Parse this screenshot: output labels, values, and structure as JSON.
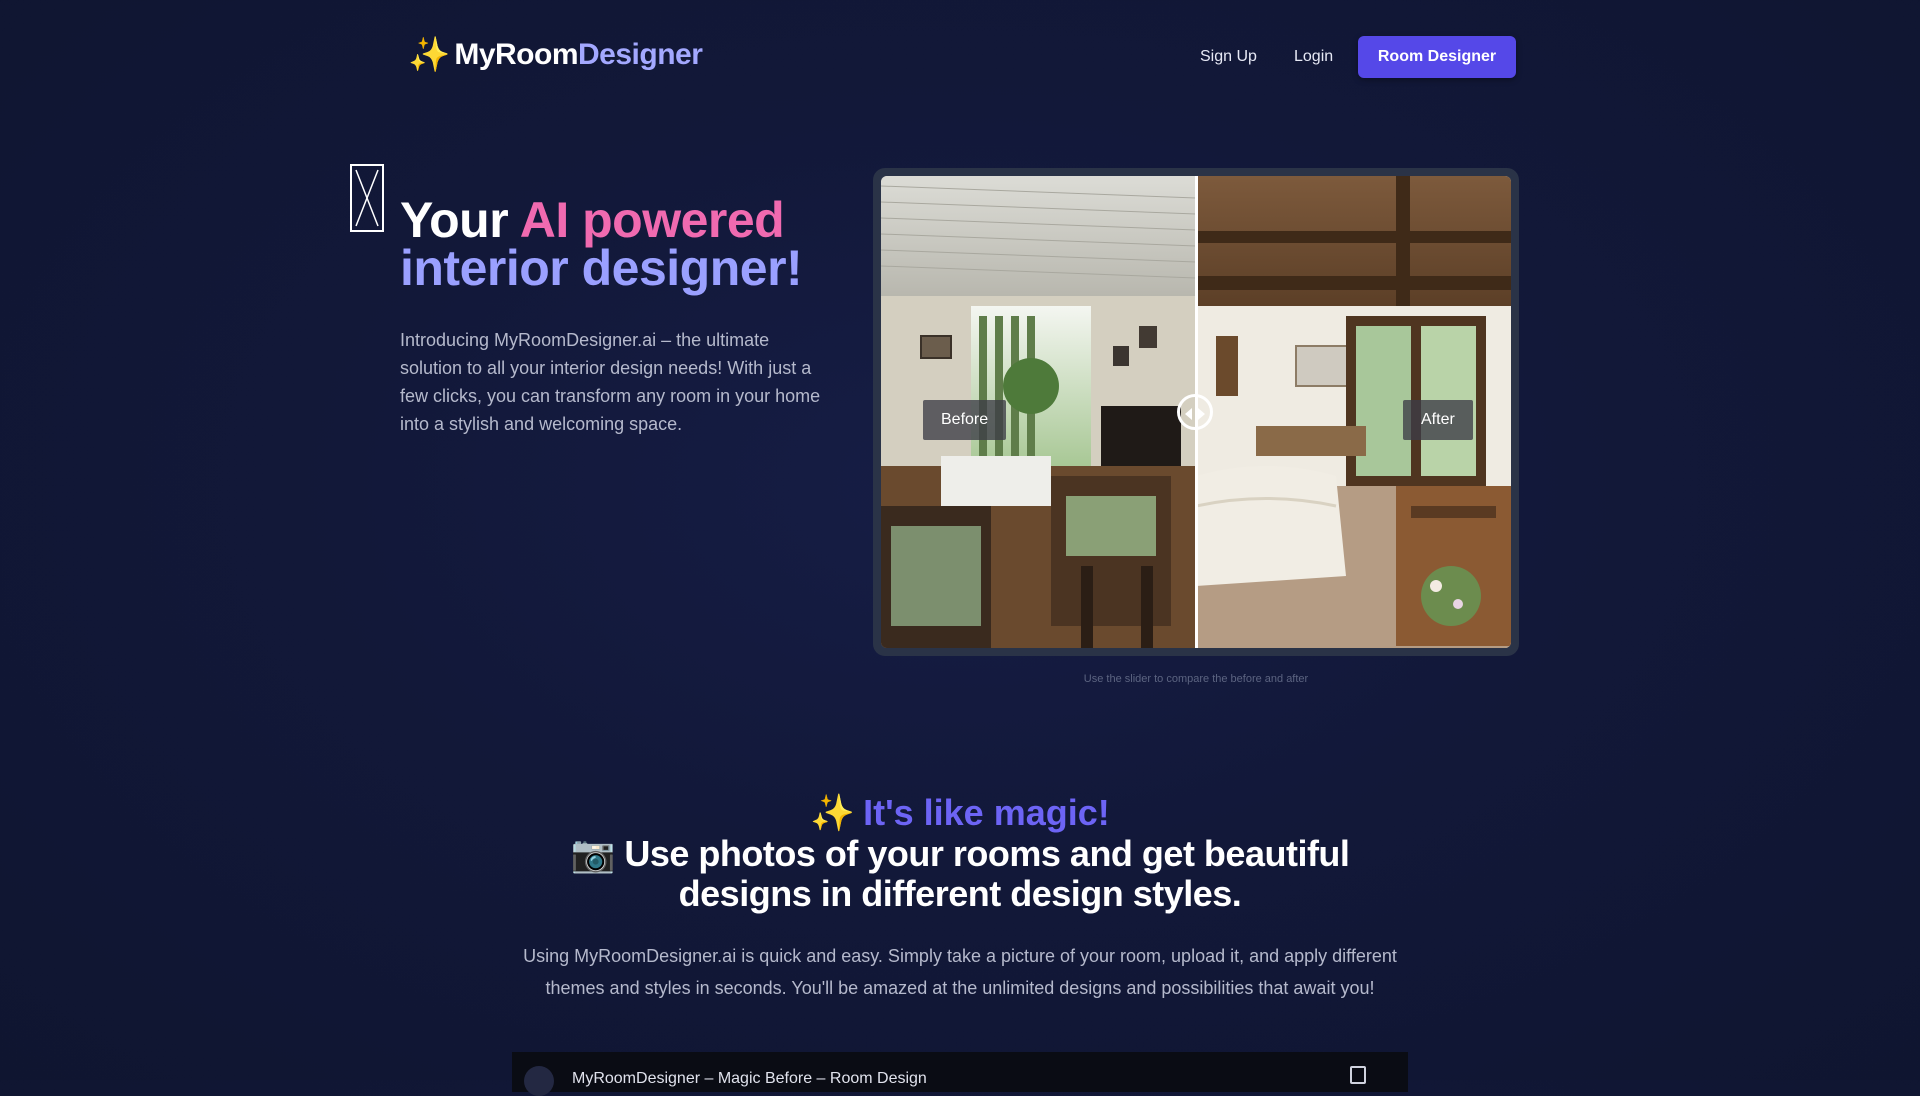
{
  "nav": {
    "logo_part1": "MyRoom",
    "logo_part2": "Designer",
    "signup_label": "Sign Up",
    "login_label": "Login",
    "cta_label": "Room Designer"
  },
  "hero": {
    "title_part1": "Your ",
    "title_part2": "AI powered",
    "title_part3": "interior designer!",
    "description": "Introducing MyRoomDesigner.ai – the ultimate solution to all your interior design needs! With just a few clicks, you can transform any room in your home into a stylish and welcoming space."
  },
  "compare": {
    "before_label": "Before",
    "after_label": "After",
    "caption": "Use the slider to compare the before and after",
    "slider_position": 0.5
  },
  "magic": {
    "heading": "It's like magic!",
    "title": "Use photos of your rooms and get beautiful designs in different design styles.",
    "description": "Using MyRoomDesigner.ai is quick and easy. Simply take a picture of your room, upload it, and apply different themes and styles in seconds. You'll be amazed at the unlimited designs and possibilities that await you!",
    "video_title": "MyRoomDesigner – Magic Before – Room Design"
  },
  "colors": {
    "background": "#131a3b",
    "accent": "#5548e8",
    "pink": "#f06ab0",
    "violet": "#9aa0ff",
    "gold": "#f5c542"
  },
  "icons": [
    "sparkles-icon",
    "broken-image-icon",
    "slider-handle-icon",
    "camera-icon",
    "copy-icon"
  ]
}
